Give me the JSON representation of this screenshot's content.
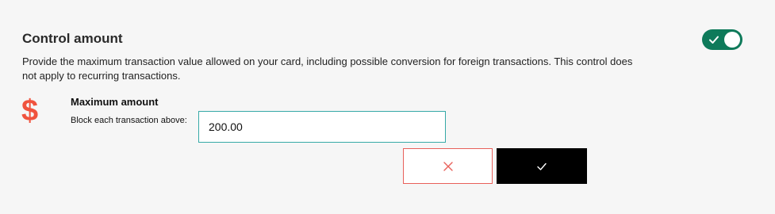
{
  "control_amount": {
    "title": "Control amount",
    "toggle_state": "on",
    "description": "Provide the maximum transaction value allowed on your card, including possible conversion for foreign transactions. This control does not apply to recurring transactions.",
    "currency_symbol": "$",
    "field_title": "Maximum amount",
    "field_label": "Block each transaction above:",
    "amount_value": "200.00",
    "cancel_icon": "close-icon",
    "confirm_icon": "check-icon"
  },
  "colors": {
    "toggle_on": "#0e7a5a",
    "currency_icon": "#f0533e",
    "input_border": "#36a9a7",
    "cancel_border": "#e8605a",
    "confirm_bg": "#000000"
  }
}
